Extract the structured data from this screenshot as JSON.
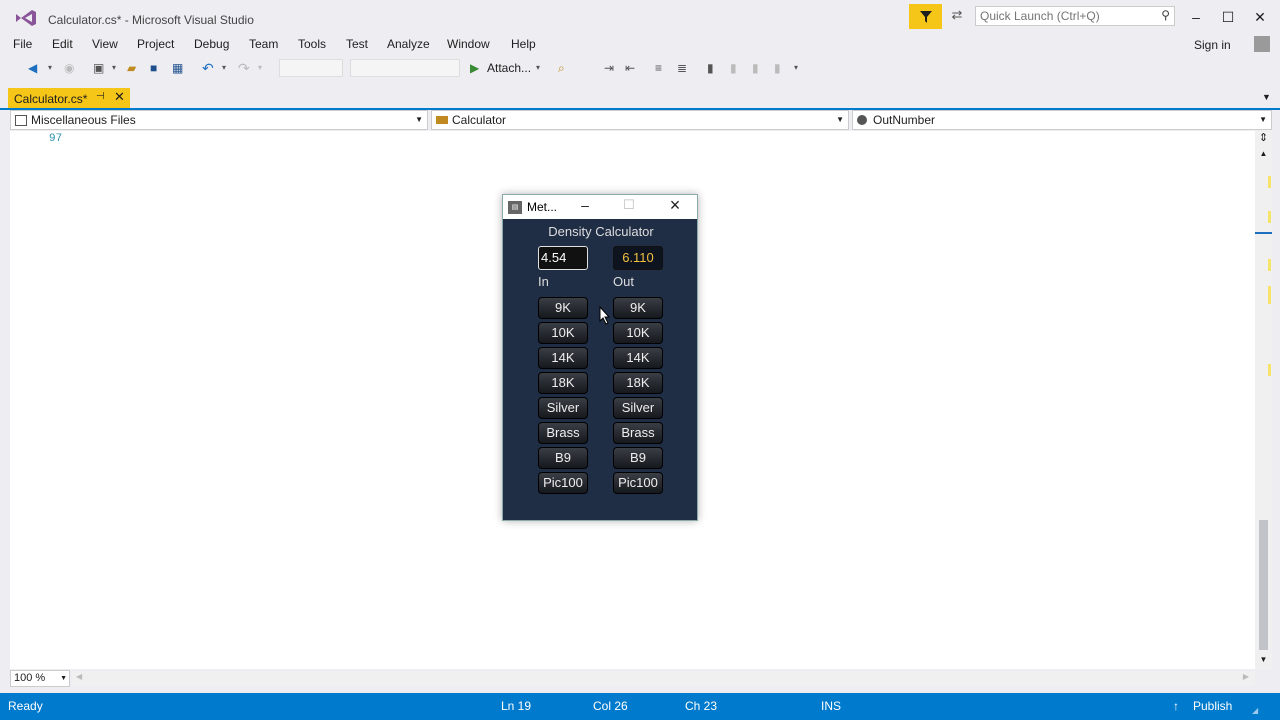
{
  "window": {
    "title": "Calculator.cs* - Microsoft Visual Studio",
    "quick_launch_placeholder": "Quick Launch (Ctrl+Q)",
    "sign_in": "Sign in"
  },
  "menu": [
    "File",
    "Edit",
    "View",
    "Project",
    "Debug",
    "Team",
    "Tools",
    "Test",
    "Analyze",
    "Window",
    "Help"
  ],
  "toolbar": {
    "attach_label": "Attach..."
  },
  "tab": {
    "label": "Calculator.cs*"
  },
  "navbar": {
    "project": "Miscellaneous Files",
    "type": "Calculator",
    "member": "OutNumber"
  },
  "editor": {
    "line_number": "97",
    "zoom": "100 %"
  },
  "status": {
    "ready": "Ready",
    "ln": "Ln 19",
    "col": "Col 26",
    "ch": "Ch 23",
    "ins": "INS",
    "publish": "Publish"
  },
  "dialog": {
    "title": "Met...",
    "heading": "Density Calculator",
    "in_value": "4.54",
    "out_value": "6.110",
    "in_label": "In",
    "out_label": "Out",
    "in_buttons": [
      "9K",
      "10K",
      "14K",
      "18K",
      "Silver",
      "Brass",
      "B9",
      "Pic100"
    ],
    "out_buttons": [
      "9K",
      "10K",
      "14K",
      "18K",
      "Silver",
      "Brass",
      "B9",
      "Pic100"
    ]
  },
  "colors": {
    "accent": "#007acc",
    "active_tab": "#f5c518",
    "dialog_bg": "#1f2d45",
    "output_text": "#f0c040"
  }
}
